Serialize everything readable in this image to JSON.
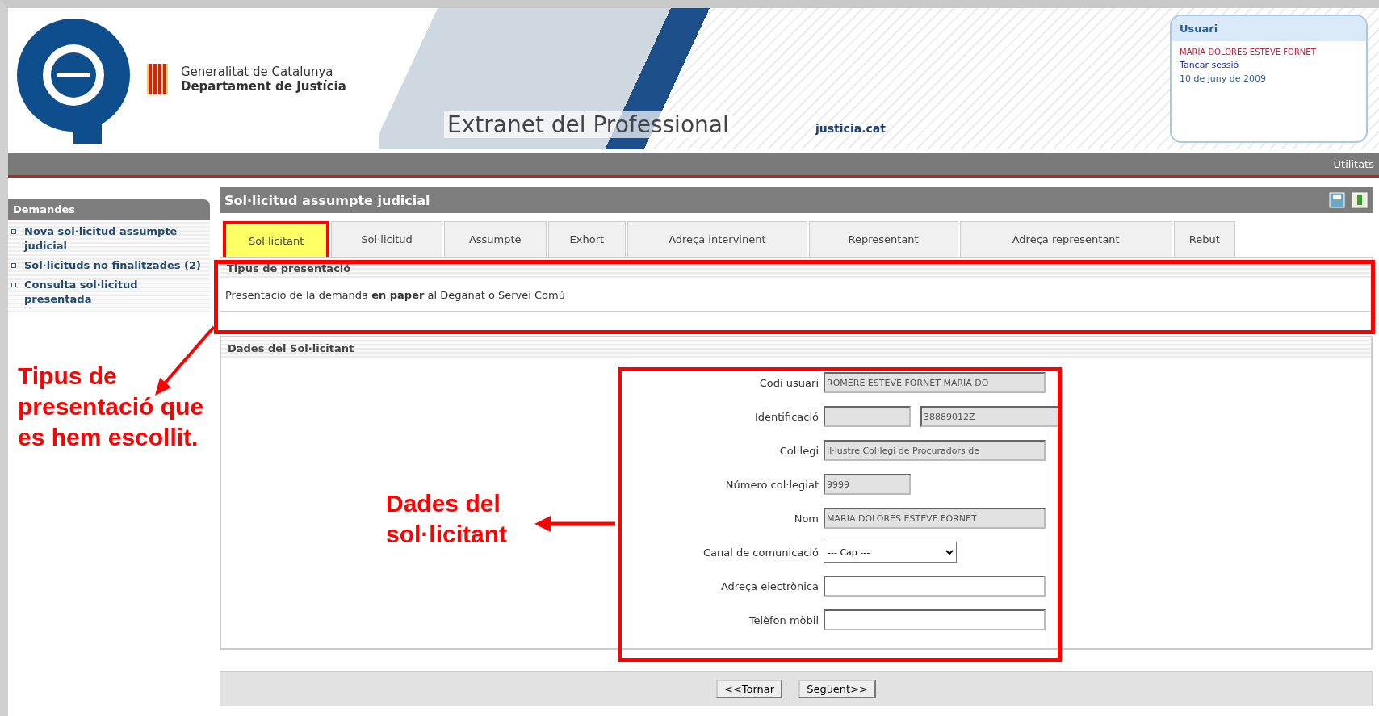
{
  "header": {
    "org_lines": [
      "Generalitat de Catalunya",
      "Departament de Justícia"
    ],
    "banner_title": "Extranet del Professional",
    "site_logo": "justicia.cat",
    "user_box": {
      "title": "Usuari",
      "name": "MARIA DOLORES ESTEVE FORNET",
      "logout": "Tancar sessió",
      "date": "10 de juny de 2009"
    }
  },
  "toolbar": {
    "link": "Utilitats"
  },
  "sidebar": {
    "title": "Demandes",
    "items": [
      {
        "label": "Nova sol·licitud assumpte judicial"
      },
      {
        "label": "Sol·licituds no finalitzades (2)"
      },
      {
        "label": "Consulta sol·licitud presentada"
      }
    ]
  },
  "panel": {
    "title": "Sol·licitud assumpte judicial",
    "tabs": [
      {
        "label": "Sol·licitant",
        "selected": true
      },
      {
        "label": "Sol·licitud",
        "selected": false
      },
      {
        "label": "Assumpte",
        "selected": false
      },
      {
        "label": "Exhort",
        "selected": false
      },
      {
        "label": "Adreça intervinent",
        "selected": false
      },
      {
        "label": "Representant",
        "selected": false
      },
      {
        "label": "Adreça representant",
        "selected": false
      },
      {
        "label": "Rebut",
        "selected": false
      }
    ],
    "presentation": {
      "title": "Tipus de presentació",
      "text": "Presentació de la demanda **en paper** al Deganat o Servei Comú"
    },
    "applicant": {
      "title": "Dades del Sol·licitant",
      "fields": [
        {
          "label": "Codi usuari",
          "kind": "text",
          "inputs": [
            {
              "value": "ROMERE ESTEVE FORNET MARIA DO",
              "disabled": true
            }
          ]
        },
        {
          "label": "Identificació",
          "kind": "text",
          "inputs": [
            {
              "disabled": true
            },
            {
              "value": "38889012Z",
              "disabled": true
            }
          ]
        },
        {
          "label": "Col·legi",
          "kind": "text",
          "inputs": [
            {
              "value": "Il·lustre Col·legi de Procuradors de",
              "disabled": true
            }
          ]
        },
        {
          "label": "Número col·legiat",
          "kind": "text",
          "inputs": [
            {
              "value": "9999",
              "disabled": true
            }
          ]
        },
        {
          "label": "Nom",
          "kind": "text",
          "inputs": [
            {
              "value": "MARIA DOLORES ESTEVE FORNET",
              "disabled": true
            }
          ]
        },
        {
          "label": "Canal de comunicació",
          "kind": "select",
          "inputs": [
            {
              "value": "--- Cap ---",
              "disabled": false
            }
          ]
        },
        {
          "label": "Adreça electrònica",
          "kind": "text",
          "inputs": [
            {
              "disabled": false
            }
          ]
        },
        {
          "label": "Telèfon mòbil",
          "kind": "text",
          "inputs": [
            {
              "disabled": false
            }
          ]
        }
      ]
    },
    "buttons": [
      "<<Tornar",
      "Següent>>"
    ]
  },
  "annotations": [
    "Tipus de presentació que es hem escollit.",
    "Dades del sol·licitant"
  ]
}
